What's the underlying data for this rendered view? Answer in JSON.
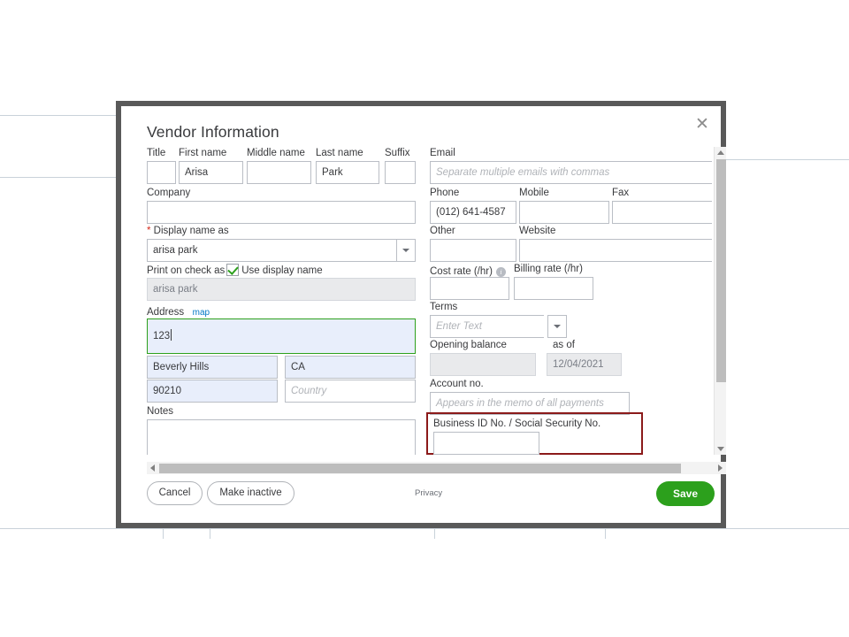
{
  "modal": {
    "title": "Vendor Information",
    "close_icon": "close-icon"
  },
  "form": {
    "left": {
      "name_labels": {
        "title": "Title",
        "first_name": "First name",
        "middle_name": "Middle name",
        "last_name": "Last name",
        "suffix": "Suffix"
      },
      "name_values": {
        "title": "",
        "first_name": "Arisa",
        "middle_name": "",
        "last_name": "Park",
        "suffix": ""
      },
      "company_label": "Company",
      "company_value": "",
      "display_name_label": "Display name as",
      "display_name_value": "arisa park",
      "print_on_check_label": "Print on check as",
      "use_display_name_label": "Use display name",
      "use_display_name_checked": true,
      "print_on_check_value": "arisa park",
      "address_label": "Address",
      "map_link": "map",
      "address_street": "123",
      "address_city": "Beverly Hills",
      "address_state": "CA",
      "address_zip": "90210",
      "address_country_placeholder": "Country",
      "address_country_value": "",
      "notes_label": "Notes",
      "notes_value": ""
    },
    "right": {
      "email_label": "Email",
      "email_placeholder": "Separate multiple emails with commas",
      "email_value": "",
      "phone_label": "Phone",
      "phone_value": "(012) 641-4587",
      "mobile_label": "Mobile",
      "mobile_value": "",
      "fax_label": "Fax",
      "fax_value": "",
      "other_label": "Other",
      "other_value": "",
      "website_label": "Website",
      "website_value": "",
      "cost_rate_label": "Cost rate (/hr)",
      "cost_rate_value": "",
      "billing_rate_label": "Billing rate (/hr)",
      "billing_rate_value": "",
      "terms_label": "Terms",
      "terms_placeholder": "Enter Text",
      "terms_value": "",
      "opening_balance_label": "Opening balance",
      "opening_balance_value": "",
      "as_of_label": "as of",
      "as_of_value": "12/04/2021",
      "account_no_label": "Account no.",
      "account_no_placeholder": "Appears in the memo of all payments",
      "account_no_value": "",
      "business_id_label": "Business ID No. / Social Security No.",
      "business_id_value": ""
    }
  },
  "footer": {
    "cancel_label": "Cancel",
    "make_inactive_label": "Make inactive",
    "privacy_label": "Privacy",
    "save_label": "Save"
  },
  "colors": {
    "accent_green": "#2ca01c",
    "link_blue": "#0077c5",
    "highlight_red": "#8b1a1a",
    "field_border": "#babec5",
    "autofill_blue": "#e8eefb"
  }
}
